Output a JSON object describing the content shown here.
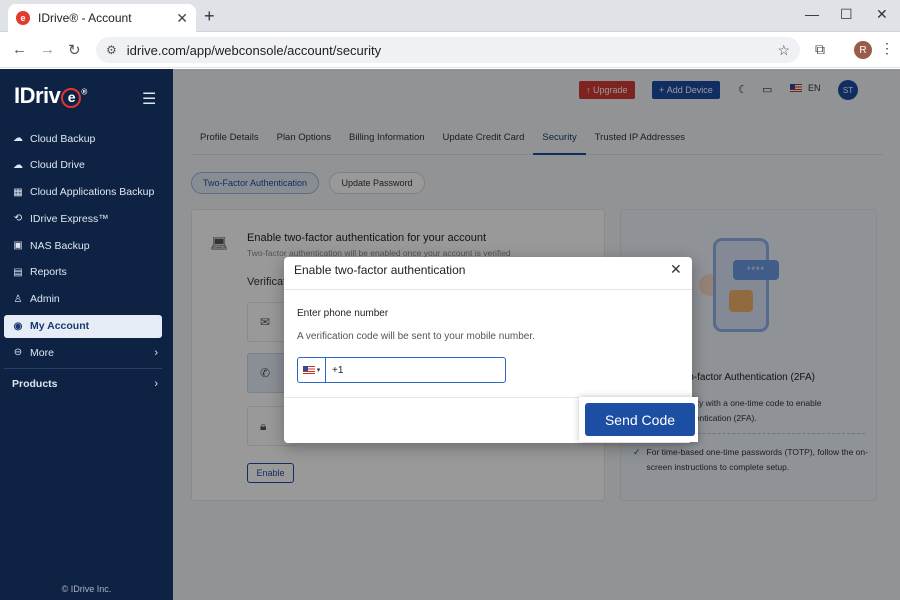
{
  "browser": {
    "tab_title": "IDrive® - Account",
    "favicon_letter": "e",
    "url": "idrive.com/app/webconsole/account/security",
    "profile_initial": "R"
  },
  "sidebar": {
    "logo_text": "IDriv",
    "logo_e": "e",
    "items": [
      {
        "label": "Cloud Backup",
        "icon": "cloud-upload-icon"
      },
      {
        "label": "Cloud Drive",
        "icon": "cloud-sync-icon"
      },
      {
        "label": "Cloud Applications Backup",
        "icon": "apps-icon"
      },
      {
        "label": "IDrive Express™",
        "icon": "express-icon"
      },
      {
        "label": "NAS Backup",
        "icon": "nas-icon"
      },
      {
        "label": "Reports",
        "icon": "reports-icon"
      },
      {
        "label": "Admin",
        "icon": "admin-icon"
      },
      {
        "label": "My Account",
        "icon": "account-icon"
      },
      {
        "label": "More",
        "icon": "more-icon"
      }
    ],
    "products_label": "Products",
    "copyright": "© IDrive Inc."
  },
  "header": {
    "upgrade_label": "Upgrade",
    "add_device_label": "Add Device",
    "lang": "EN",
    "avatar_initials": "ST"
  },
  "tabs": [
    "Profile Details",
    "Plan Options",
    "Billing Information",
    "Update Credit Card",
    "Security",
    "Trusted IP Addresses"
  ],
  "pills": {
    "two_factor": "Two-Factor Authentication",
    "update_password": "Update Password"
  },
  "left_card": {
    "heading": "Enable two-factor authentication for your account",
    "sub": "Two-factor authentication will be enabled once your account is verified",
    "verification_label": "Verificat",
    "enable_label": "Enable"
  },
  "right_card": {
    "bubble_text": "****",
    "title": "wo-factor Authentication (2FA)",
    "text": "entity with a one-time code to enable\nuthentication (2FA).",
    "bullet": "For time-based one-time passwords (TOTP), follow the on-screen instructions to complete setup."
  },
  "modal": {
    "title": "Enable two-factor authentication",
    "label": "Enter phone number",
    "description": "A verification code will be sent to your mobile number.",
    "phone_value": "+1",
    "send_label": "Send Code"
  },
  "colors": {
    "primary": "#1c4ea3",
    "sidebar": "#0e2344",
    "danger": "#d23b35"
  }
}
